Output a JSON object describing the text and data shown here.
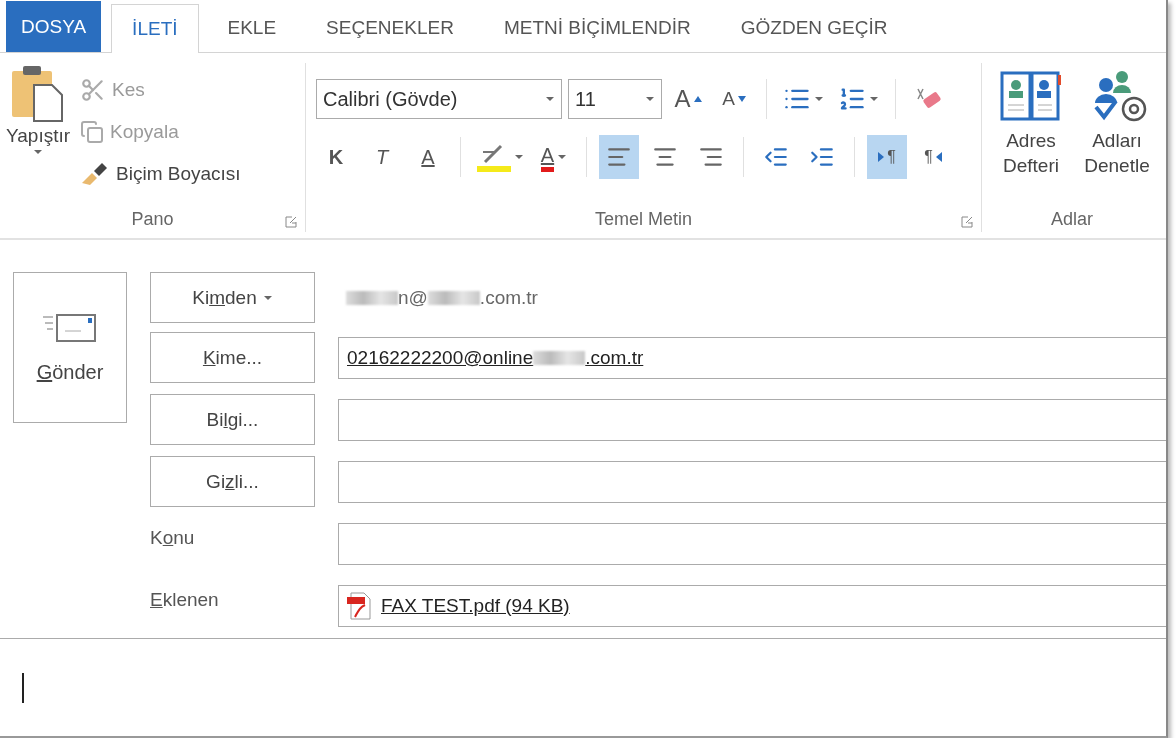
{
  "tabs": [
    {
      "label": "DOSYA",
      "kind": "file",
      "selected": false
    },
    {
      "label": "İLETİ",
      "kind": "tab",
      "selected": true
    },
    {
      "label": "EKLE",
      "kind": "tab",
      "selected": false
    },
    {
      "label": "SEÇENEKLER",
      "kind": "tab",
      "selected": false
    },
    {
      "label": "METNİ BİÇİMLENDİR",
      "kind": "tab",
      "selected": false
    },
    {
      "label": "GÖZDEN GEÇİR",
      "kind": "tab",
      "selected": false
    }
  ],
  "ribbon": {
    "clipboard": {
      "paste": "Yapıştır",
      "cut": "Kes",
      "copy": "Kopyala",
      "painter": "Biçim Boyacısı",
      "group": "Pano"
    },
    "basic_text": {
      "font": "Calibri (Gövde)",
      "size": "11",
      "grow": "A",
      "shrink": "A",
      "format_buttons": [
        {
          "label": "K",
          "kind": "bold"
        },
        {
          "label": "T",
          "kind": "italic"
        },
        {
          "label": "A",
          "kind": "underline"
        }
      ],
      "font_color": "A",
      "align": [
        {
          "kind": "left",
          "selected": true
        },
        {
          "kind": "center",
          "selected": false
        },
        {
          "kind": "right",
          "selected": false
        }
      ],
      "direction": [
        {
          "kind": "ltr",
          "label": "¶",
          "selected": true
        },
        {
          "kind": "rtl",
          "label": "¶",
          "selected": false
        }
      ],
      "group": "Temel Metin"
    },
    "names": {
      "buttons": [
        {
          "label": "Adres Defteri",
          "kind": "book"
        },
        {
          "label": "Adları Denetle",
          "kind": "check"
        }
      ],
      "group": "Adlar"
    }
  },
  "compose": {
    "send": {
      "key": "G",
      "after": "önder"
    },
    "rows": [
      {
        "kind": "dropdown",
        "label": {
          "before": "Ki",
          "key": "m",
          "after": "den"
        },
        "segments": [
          {
            "kind": "redacted"
          },
          {
            "kind": "text",
            "text": "n@"
          },
          {
            "kind": "redacted"
          },
          {
            "kind": "text",
            "text": ".com.tr"
          }
        ]
      },
      {
        "kind": "button",
        "label": {
          "key": "K",
          "after": "ime..."
        },
        "segments": [
          {
            "kind": "link",
            "text": "02162222200@online"
          },
          {
            "kind": "redacted"
          },
          {
            "kind": "link",
            "text": ".com.tr"
          }
        ]
      },
      {
        "kind": "button",
        "label": {
          "before": "Bi",
          "key": "l",
          "after": "gi..."
        }
      },
      {
        "kind": "button",
        "label": {
          "before": "Gi",
          "key": "z",
          "after": "li..."
        }
      },
      {
        "kind": "text",
        "label": {
          "before": "K",
          "key": "o",
          "after": "nu"
        }
      },
      {
        "kind": "attachment",
        "label": {
          "key": "E",
          "after": "klenen"
        },
        "file": "FAX TEST.pdf (94 KB)"
      }
    ]
  }
}
